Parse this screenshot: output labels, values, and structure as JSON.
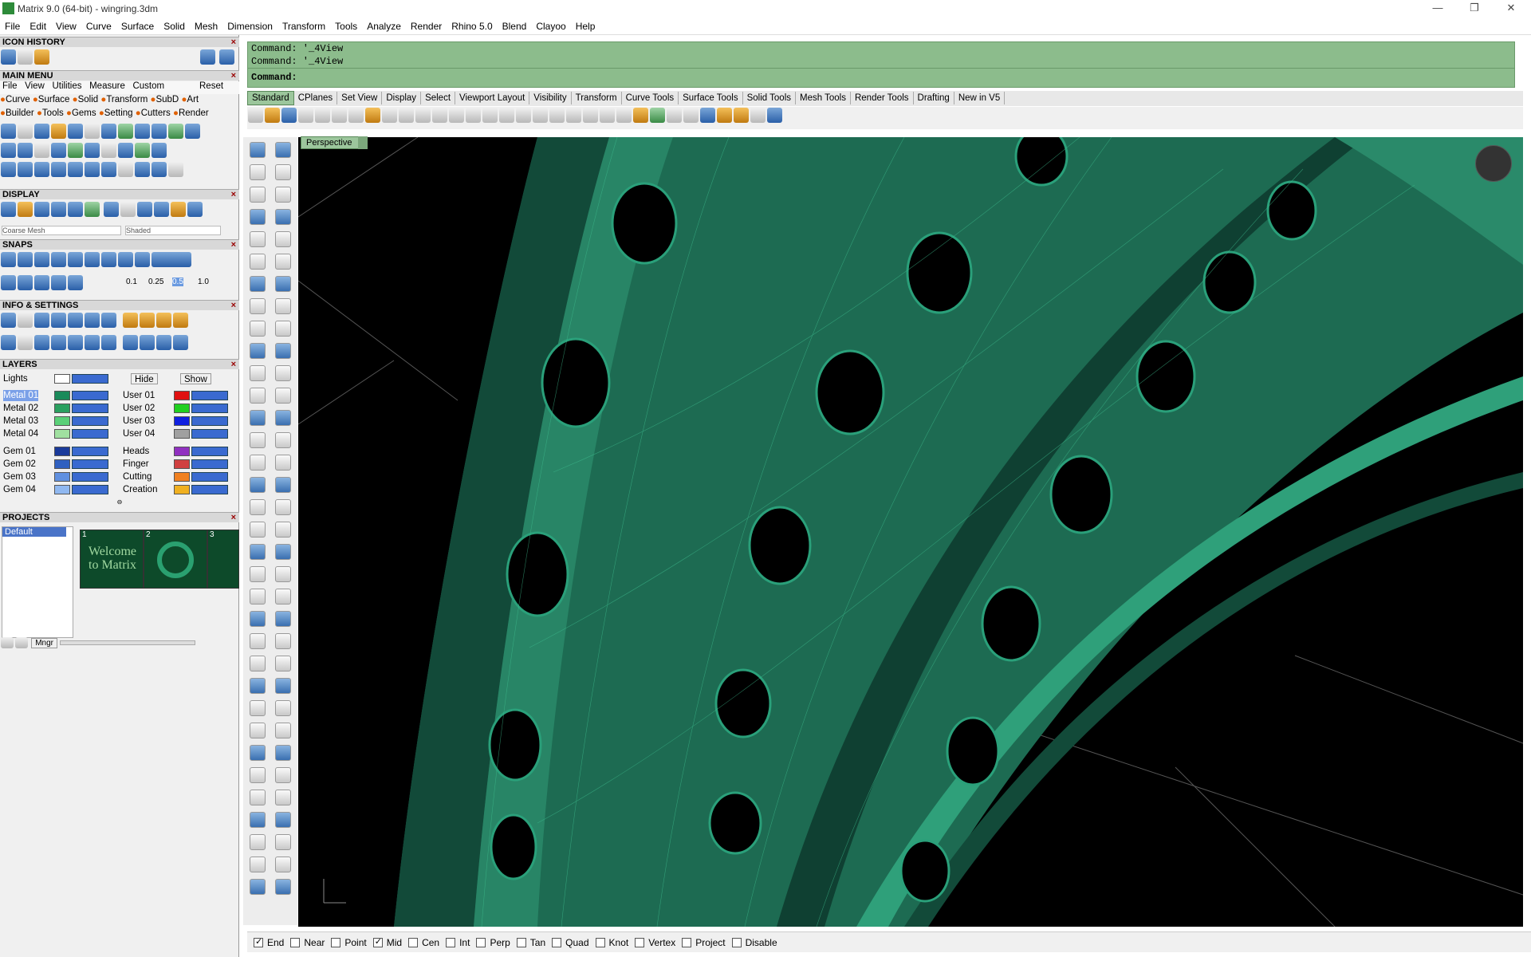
{
  "window": {
    "title": "Matrix 9.0 (64-bit) - wingring.3dm",
    "minimize": "—",
    "restore": "❐",
    "close": "✕"
  },
  "menu": [
    "File",
    "Edit",
    "View",
    "Curve",
    "Surface",
    "Solid",
    "Mesh",
    "Dimension",
    "Transform",
    "Tools",
    "Analyze",
    "Render",
    "Rhino 5.0",
    "Blend",
    "Clayoo",
    "Help"
  ],
  "panels": {
    "icon_history": "ICON HISTORY",
    "main_menu": "MAIN MENU",
    "main_menu_row1": [
      "File",
      "View",
      "Utilities",
      "Measure",
      "Custom"
    ],
    "reset": "Reset",
    "main_menu_row2": [
      "Curve",
      "Surface",
      "Solid",
      "Transform",
      "SubD",
      "Art"
    ],
    "main_menu_row3": [
      "Builder",
      "Tools",
      "Gems",
      "Setting",
      "Cutters",
      "Render"
    ],
    "display": "DISPLAY",
    "display_mesh": "Coarse Mesh",
    "display_mode": "Shaded",
    "snaps": "SNAPS",
    "snap_values": [
      "0.1",
      "0.25",
      "0.5",
      "1.0"
    ],
    "info": "INFO & SETTINGS",
    "layers": "LAYERS",
    "lights": "Lights",
    "hide": "Hide",
    "show": "Show",
    "layers_left": [
      "Metal 01",
      "Metal 02",
      "Metal 03",
      "Metal 04",
      "Gem 01",
      "Gem 02",
      "Gem 03",
      "Gem 04"
    ],
    "layers_right": [
      "User 01",
      "User 02",
      "User 03",
      "User 04",
      "Heads",
      "Finger",
      "Cutting",
      "Creation"
    ],
    "projects": "PROJECTS",
    "project_default": "Default",
    "thumb_numbers": [
      "1",
      "2",
      "3"
    ],
    "thumb1_text": "Welcome to Matrix",
    "mngr": "Mngr"
  },
  "command": {
    "line1": "Command: '_4View",
    "line2": "Command: '_4View",
    "prompt": "Command:"
  },
  "tabs": [
    "Standard",
    "CPlanes",
    "Set View",
    "Display",
    "Select",
    "Viewport Layout",
    "Visibility",
    "Transform",
    "Curve Tools",
    "Surface Tools",
    "Solid Tools",
    "Mesh Tools",
    "Render Tools",
    "Drafting",
    "New in V5"
  ],
  "viewport": {
    "name": "Perspective"
  },
  "status": {
    "snaps": [
      {
        "label": "End",
        "on": true
      },
      {
        "label": "Near",
        "on": false
      },
      {
        "label": "Point",
        "on": false
      },
      {
        "label": "Mid",
        "on": true
      },
      {
        "label": "Cen",
        "on": false
      },
      {
        "label": "Int",
        "on": false
      },
      {
        "label": "Perp",
        "on": false
      },
      {
        "label": "Tan",
        "on": false
      },
      {
        "label": "Quad",
        "on": false
      },
      {
        "label": "Knot",
        "on": false
      },
      {
        "label": "Vertex",
        "on": false
      },
      {
        "label": "Project",
        "on": false
      },
      {
        "label": "Disable",
        "on": false
      }
    ]
  },
  "colors": {
    "command_bg": "#8cbc8c",
    "viewport_bg": "#000000",
    "ring": "#1f7a5c",
    "layer_swatches_left": [
      "#1a8a5a",
      "#2aa060",
      "#5ad078",
      "#a0e0a0",
      "#1a3a9a",
      "#3060c0",
      "#6090e0",
      "#90b8f0"
    ],
    "layer_swatches_right": [
      "#e01010",
      "#20d020",
      "#1020e0",
      "#a0a0a0",
      "#9030c0",
      "#d04040",
      "#f08020",
      "#f0b020"
    ]
  }
}
